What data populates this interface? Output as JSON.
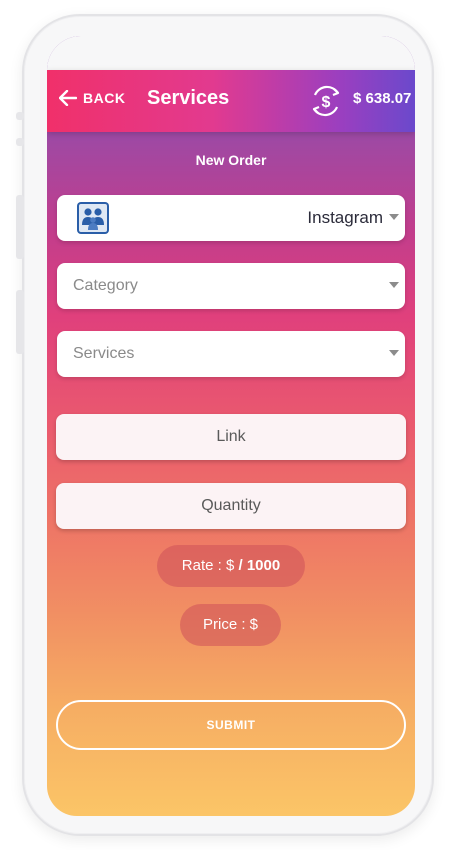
{
  "header": {
    "back_label": "BACK",
    "title": "Services",
    "balance": "$ 638.07"
  },
  "form": {
    "section_title": "New Order",
    "platform_value": "Instagram",
    "category_placeholder": "Category",
    "services_placeholder": "Services",
    "link_placeholder": "Link",
    "quantity_placeholder": "Quantity",
    "rate_prefix": "Rate : $",
    "rate_suffix": " / 1000",
    "price_label": "Price : $",
    "submit_label": "SUBMIT"
  },
  "colors": {
    "app_bar_start": "#f0306a",
    "app_bar_end": "#6b49cc",
    "gradient_top": "#8a4fb2",
    "gradient_bottom": "#fbc567"
  },
  "icons": {
    "back": "arrow-left-icon",
    "refresh": "dollar-refresh-icon",
    "platform": "people-group-icon",
    "caret": "caret-down-icon"
  }
}
